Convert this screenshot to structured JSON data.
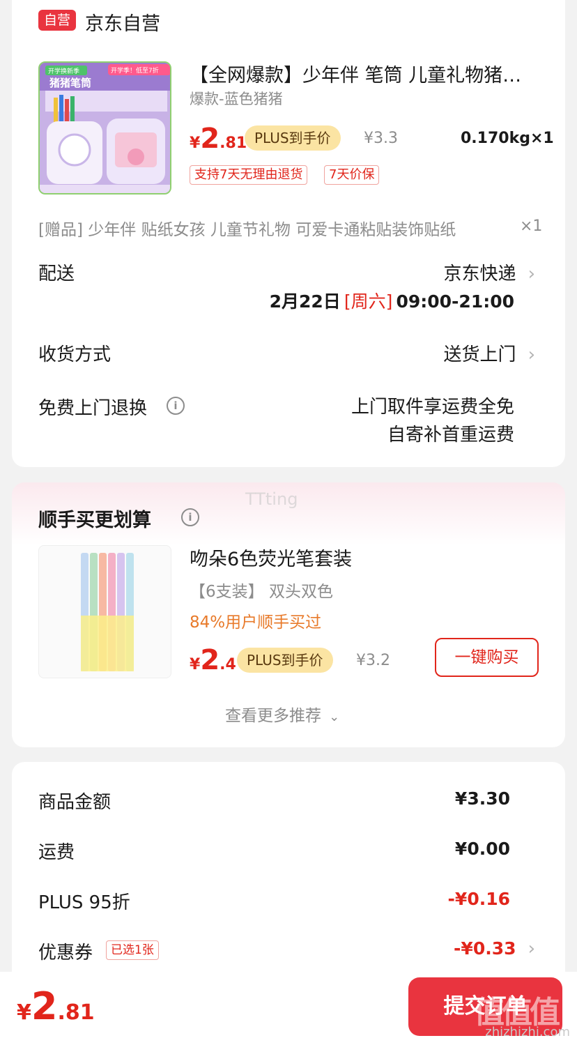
{
  "store": {
    "badge": "自营",
    "name": "京东自营"
  },
  "product": {
    "title": "【全网爆款】少年伴 笔筒 儿童礼物猪猪笔筒",
    "variant": "爆款-蓝色猪猪",
    "price_symbol": "¥",
    "price_int": "2",
    "price_dec": ".81",
    "plus_label": "PLUS到手价",
    "original_price": "¥3.3",
    "weight_qty": "0.170kg×1",
    "tags": [
      "支持7天无理由退货",
      "7天价保"
    ],
    "image_texts": {
      "top_left": "开学换新季",
      "top_right": "开学季！低至7折",
      "title": "猪猪笔筒"
    }
  },
  "gift": {
    "text": "[赠品] 少年伴 贴纸女孩 儿童节礼物 可爱卡通粘贴装饰贴纸",
    "qty": "×1"
  },
  "delivery": {
    "label": "配送",
    "carrier": "京东快递",
    "date": "2月22日",
    "weekday": "[周六]",
    "time": "09:00-21:00"
  },
  "receive": {
    "label": "收货方式",
    "value": "送货上门"
  },
  "returns": {
    "label": "免费上门退换",
    "line1": "上门取件享运费全免",
    "line2": "自寄补首重运费"
  },
  "recommend": {
    "title": "顺手买更划算",
    "watermark": "TTting",
    "item_name": "吻朵6色荧光笔套装",
    "item_spec": "【6支装】 双头双色",
    "item_note": "84%用户顺手买过",
    "price_symbol": "¥",
    "price_int": "2",
    "price_dec": ".4",
    "plus_label": "PLUS到手价",
    "original_price": "¥3.2",
    "buy_label": "一键购买",
    "more_label": "查看更多推荐"
  },
  "summary": {
    "rows": [
      {
        "label": "商品金额",
        "value": "¥3.30"
      },
      {
        "label": "运费",
        "value": "¥0.00"
      },
      {
        "label": "PLUS 95折",
        "value": "-¥0.16"
      },
      {
        "label": "优惠券",
        "badge": "已选1张",
        "value": "-¥0.33"
      }
    ]
  },
  "bottom": {
    "price_symbol": "¥",
    "price_int": "2",
    "price_dec": ".81",
    "submit_label": "提交订单",
    "watermark": "zhizhizhi.com",
    "logo": "值值值"
  },
  "colors": {
    "accent": "#e1251b",
    "badge": "#e9343f",
    "plus": "#fbe4a3"
  }
}
